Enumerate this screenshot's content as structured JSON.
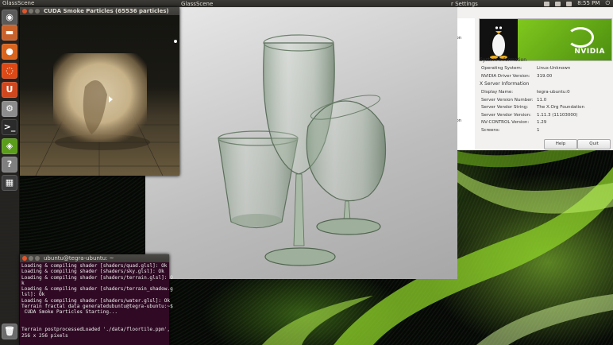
{
  "top_panel": {
    "app_name": "GlassScene",
    "time": "8:55 PM"
  },
  "launcher": {
    "items": [
      {
        "icon": "ubuntu-dash-icon",
        "color": "#5a5a5a",
        "glyph": "◉"
      },
      {
        "icon": "files-icon",
        "color": "#c9612a",
        "glyph": "▬"
      },
      {
        "icon": "firefox-icon",
        "color": "#d9641e",
        "glyph": "●"
      },
      {
        "icon": "ubuntu-one-icon",
        "color": "#dd4814",
        "glyph": "◌"
      },
      {
        "icon": "software-center-icon",
        "color": "#d0471d",
        "glyph": "U"
      },
      {
        "icon": "settings-icon",
        "color": "#8c8c8c",
        "glyph": "⚙"
      },
      {
        "icon": "terminal-icon",
        "color": "#2b2b2b",
        "glyph": ">_"
      },
      {
        "icon": "nvidia-settings-icon",
        "color": "#5a9d1a",
        "glyph": "◈"
      },
      {
        "icon": "help-icon",
        "color": "#7f7f7f",
        "glyph": "?"
      },
      {
        "icon": "workspace-switcher-icon",
        "color": "#3d3d3d",
        "glyph": "▦"
      },
      {
        "icon": "trash-icon",
        "color": "#6c6c6c",
        "glyph": "🗑"
      }
    ]
  },
  "smoke_window": {
    "title": "CUDA Smoke Particles (65536 particles)"
  },
  "glass_window": {
    "title": "GlassScene"
  },
  "nvidia_settings": {
    "title_fragment": "r Settings",
    "sidebar": [
      "ration",
      "gs",
      "ion",
      "ration"
    ],
    "logo": "NVIDIA",
    "system_info_heading": "System Information",
    "system_info": [
      {
        "label": "Operating System:",
        "value": "Linux-Unknown"
      },
      {
        "label": "NVIDIA Driver Version:",
        "value": "319.00"
      }
    ],
    "x_server_heading": "X Server Information",
    "x_server": [
      {
        "label": "Display Name:",
        "value": "tegra-ubuntu:0"
      },
      {
        "label": "Server Version Number:",
        "value": "11.0"
      },
      {
        "label": "Server Vendor String:",
        "value": "The X.Org Foundation"
      },
      {
        "label": "Server Vendor Version:",
        "value": "1.11.3 (11103000)"
      },
      {
        "label": "NV-CONTROL Version:",
        "value": "1.29"
      },
      {
        "label": "Screens:",
        "value": "1"
      }
    ],
    "help_button": "Help",
    "quit_button": "Quit"
  },
  "terminal": {
    "title": "ubuntu@tegra-ubuntu: ~",
    "lines": [
      "Loading & compiling shader [shaders/quad.glsl]: Ok",
      "Loading & compiling shader [shaders/sky.glsl]: Ok",
      "Loading & compiling shader [shaders/terrain.glsl]: O",
      "k",
      "Loading & compiling shader [shaders/terrain_shadow.g",
      "lsl]: Ok",
      "Loading & compiling shader [shaders/water.glsl]: Ok",
      "Terrain fractal data generatedubuntu@tegra-ubuntu:~$",
      " CUDA Smoke Particles Starting...",
      "",
      "",
      "Terrain postprocessedLoaded './data/floortile.ppm',",
      "256 x 256 pixels"
    ]
  }
}
